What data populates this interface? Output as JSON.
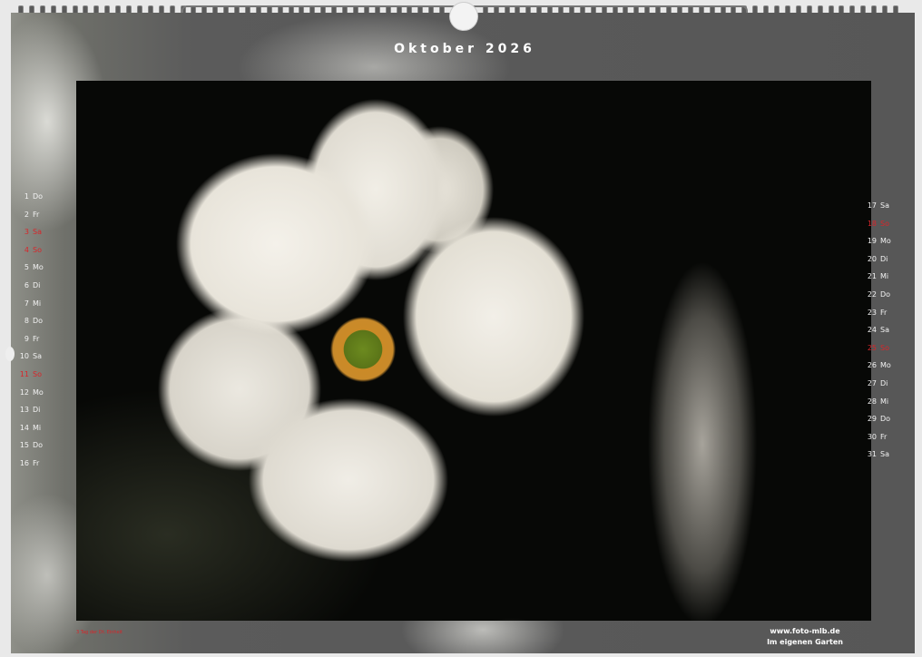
{
  "title": "Oktober 2026",
  "days": [
    {
      "n": "1",
      "d": "Do",
      "holiday": false
    },
    {
      "n": "2",
      "d": "Fr",
      "holiday": false
    },
    {
      "n": "3",
      "d": "Sa",
      "holiday": true
    },
    {
      "n": "4",
      "d": "So",
      "holiday": true
    },
    {
      "n": "5",
      "d": "Mo",
      "holiday": false
    },
    {
      "n": "6",
      "d": "Di",
      "holiday": false
    },
    {
      "n": "7",
      "d": "Mi",
      "holiday": false
    },
    {
      "n": "8",
      "d": "Do",
      "holiday": false
    },
    {
      "n": "9",
      "d": "Fr",
      "holiday": false
    },
    {
      "n": "10",
      "d": "Sa",
      "holiday": false
    },
    {
      "n": "11",
      "d": "So",
      "holiday": true
    },
    {
      "n": "12",
      "d": "Mo",
      "holiday": false
    },
    {
      "n": "13",
      "d": "Di",
      "holiday": false
    },
    {
      "n": "14",
      "d": "Mi",
      "holiday": false
    },
    {
      "n": "15",
      "d": "Do",
      "holiday": false
    },
    {
      "n": "16",
      "d": "Fr",
      "holiday": false
    },
    {
      "n": "17",
      "d": "Sa",
      "holiday": false
    },
    {
      "n": "18",
      "d": "So",
      "holiday": true
    },
    {
      "n": "19",
      "d": "Mo",
      "holiday": false
    },
    {
      "n": "20",
      "d": "Di",
      "holiday": false
    },
    {
      "n": "21",
      "d": "Mi",
      "holiday": false
    },
    {
      "n": "22",
      "d": "Do",
      "holiday": false
    },
    {
      "n": "23",
      "d": "Fr",
      "holiday": false
    },
    {
      "n": "24",
      "d": "Sa",
      "holiday": false
    },
    {
      "n": "25",
      "d": "So",
      "holiday": true
    },
    {
      "n": "26",
      "d": "Mo",
      "holiday": false
    },
    {
      "n": "27",
      "d": "Di",
      "holiday": false
    },
    {
      "n": "28",
      "d": "Mi",
      "holiday": false
    },
    {
      "n": "29",
      "d": "Do",
      "holiday": false
    },
    {
      "n": "30",
      "d": "Fr",
      "holiday": false
    },
    {
      "n": "31",
      "d": "Sa",
      "holiday": false
    }
  ],
  "footer": {
    "holiday_note": "3 Tag der Dt. Einheit",
    "website": "www.foto-mlb.de",
    "photo_title": "Im eigenen Garten"
  },
  "colors": {
    "holiday": "#d8262a",
    "text": "#f2f2f2"
  }
}
